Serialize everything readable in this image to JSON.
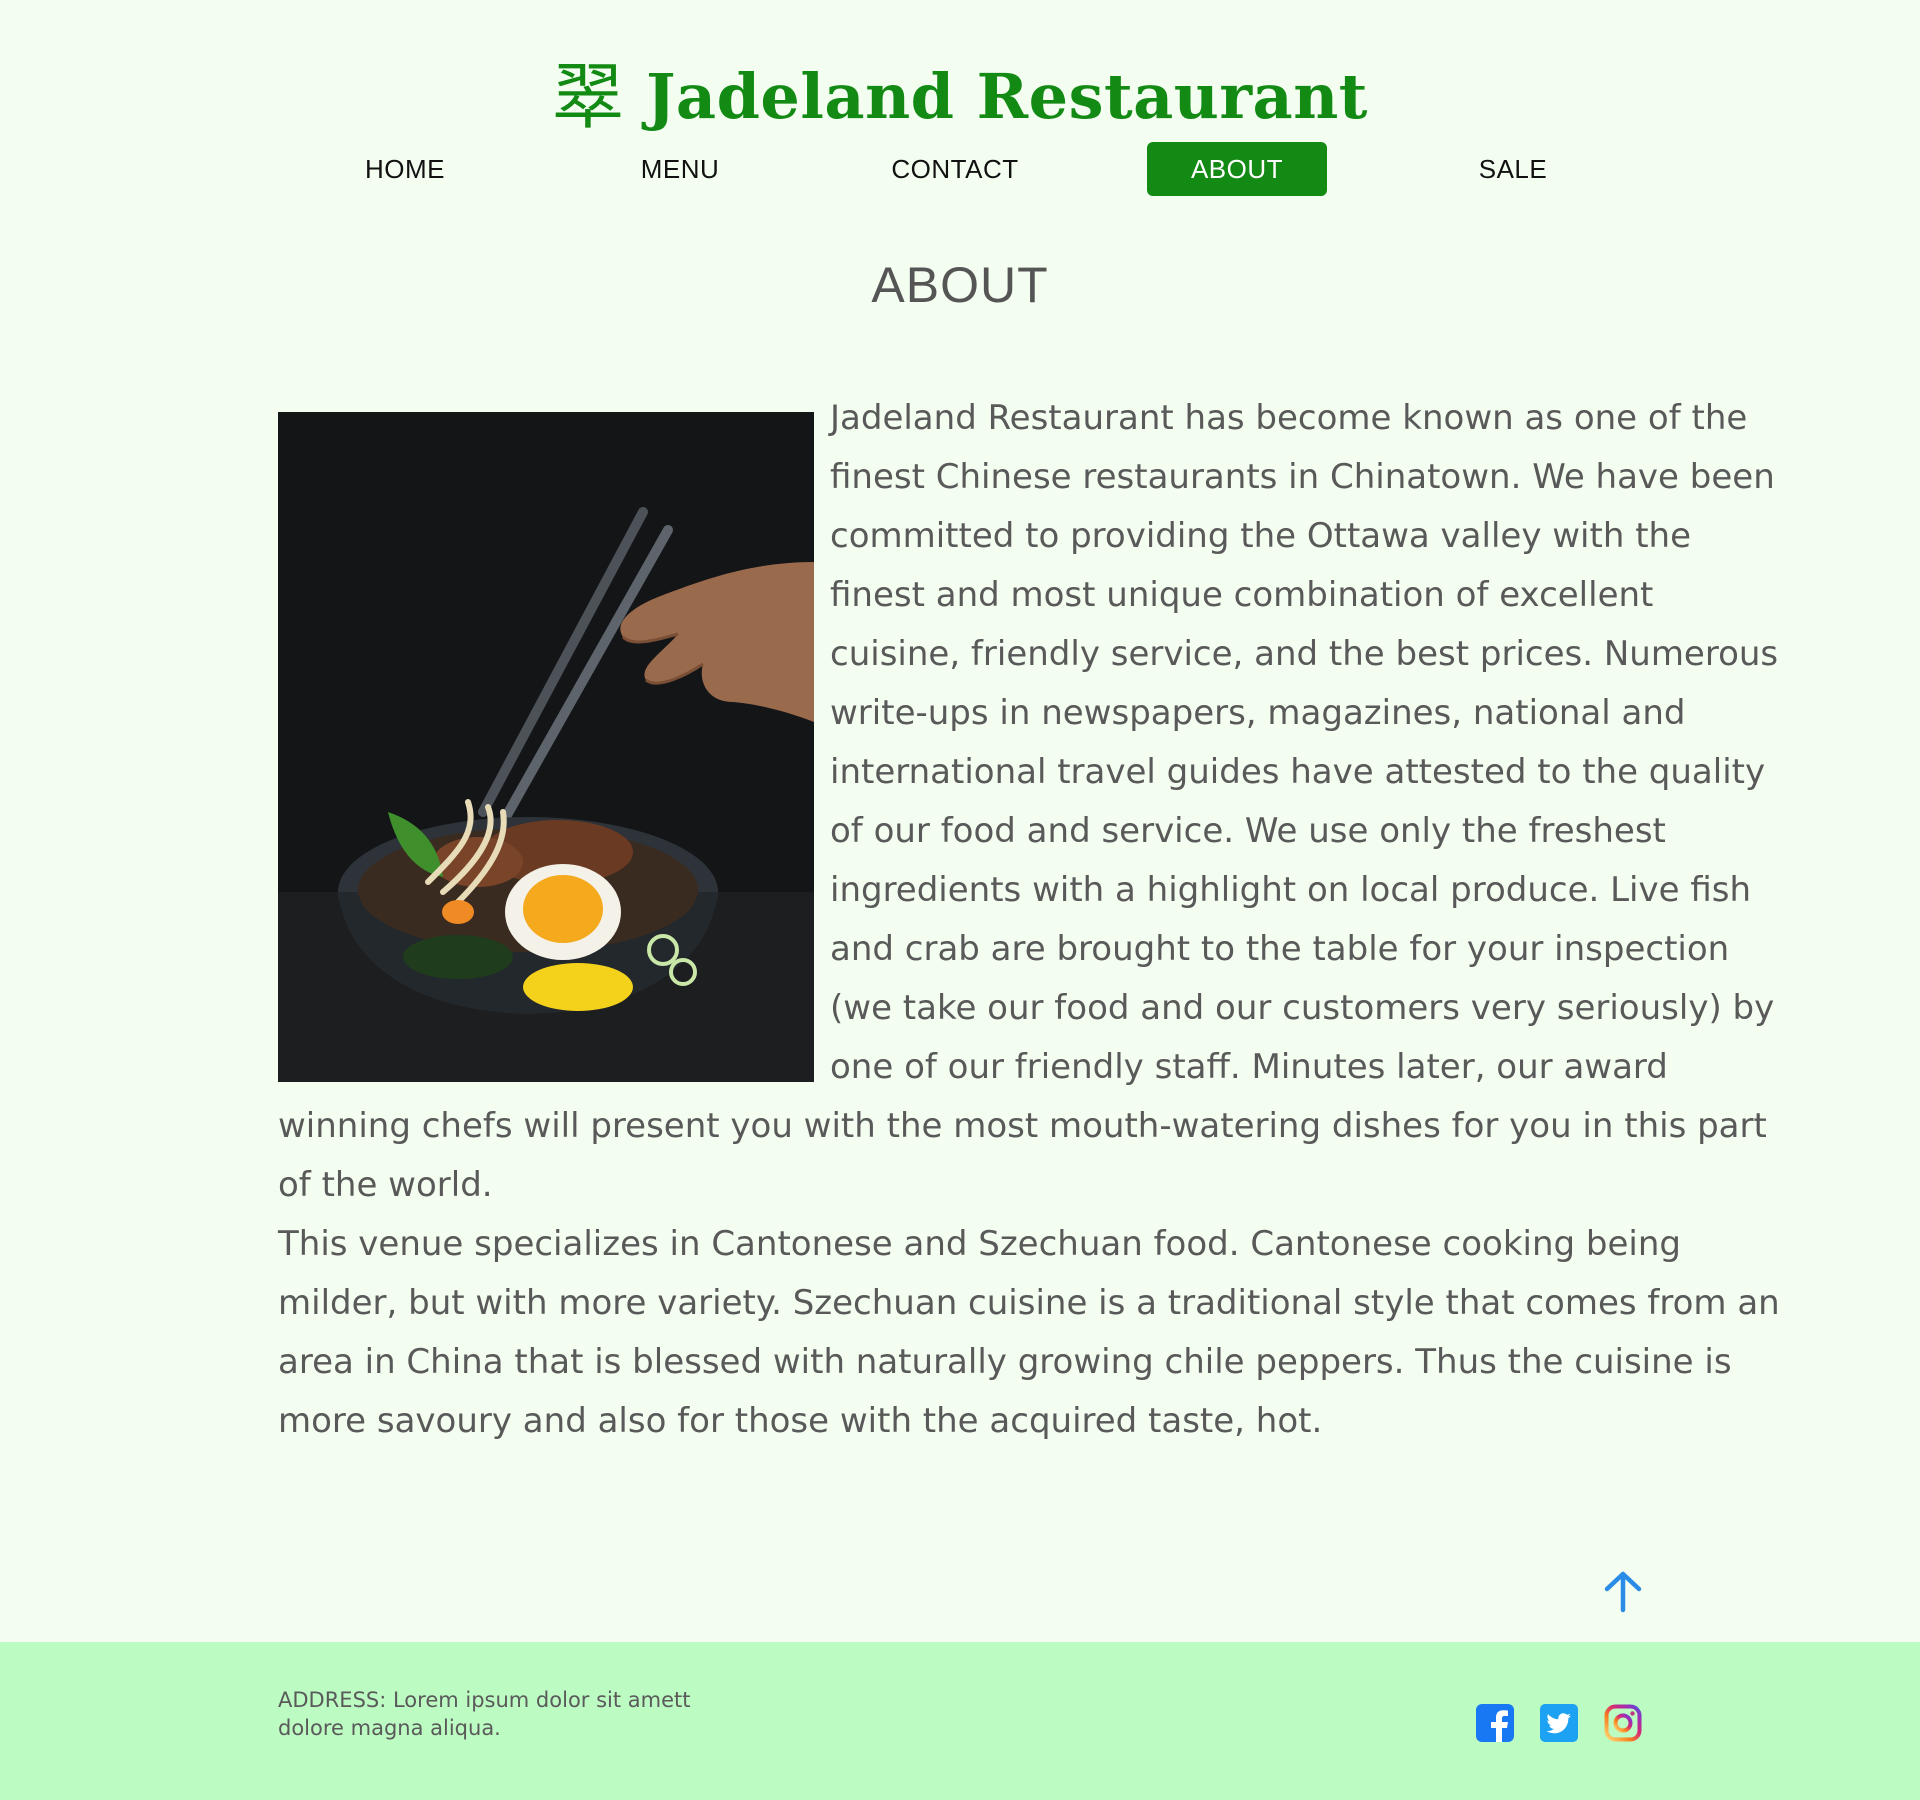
{
  "header": {
    "logo_glyph": "翠",
    "brand_name": "Jadeland Restaurant",
    "brand_color": "#138a13"
  },
  "nav": {
    "items": [
      {
        "label": "HOME",
        "active": false
      },
      {
        "label": "MENU",
        "active": false
      },
      {
        "label": "CONTACT",
        "active": false
      },
      {
        "label": "ABOUT",
        "active": true
      },
      {
        "label": "SALE",
        "active": false
      }
    ]
  },
  "main": {
    "title": "ABOUT",
    "image_icon": "ramen-bowl-with-chopsticks-photo",
    "paragraphs": [
      "Jadeland Restaurant has become known as one of the finest Chinese restaurants in Chinatown. We have been committed to providing the Ottawa valley with the finest and most unique combination of excellent cuisine, friendly service, and the best prices.  Numerous write-ups in newspapers, magazines, national and international travel guides have attested to the quality of our food and service. We use only the freshest ingredients with a highlight on local produce. Live fish and crab are brought to the table for your inspection (we take our food and our customers very seriously) by one of our friendly staff. Minutes later, our award winning chefs will present you with the most mouth-watering dishes for you in this part of the world.",
      "This venue specializes in Cantonese and Szechuan food. Cantonese cooking being milder, but with more variety. Szechuan cuisine is a traditional style that comes from an area in China that is blessed with naturally growing chile peppers. Thus the cuisine is more savoury and also for those with the acquired taste, hot."
    ],
    "back_to_top_icon": "arrow-up-icon",
    "back_to_top_color": "#2b8ce8"
  },
  "footer": {
    "address": "ADDRESS: Lorem ipsum dolor sit amett dolore magna aliqua.",
    "background": "#bcfbc2",
    "social": [
      {
        "icon": "facebook-icon",
        "color": "#1877f2"
      },
      {
        "icon": "twitter-icon",
        "color": "#1da1f2"
      },
      {
        "icon": "instagram-icon",
        "color": "#e1306c"
      }
    ]
  },
  "colors": {
    "page_background": "#f3fef1",
    "active_nav_background": "#138a13",
    "active_nav_text": "#ffffff",
    "body_text": "#595959"
  }
}
